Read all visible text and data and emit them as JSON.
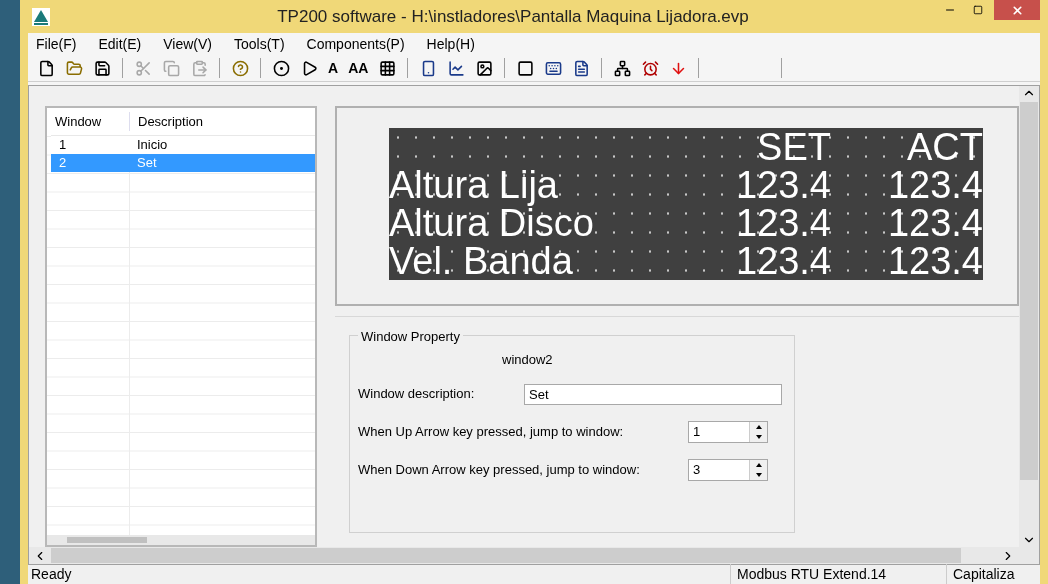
{
  "window": {
    "title": "TP200 software - H:\\instladores\\Pantalla Maquina Lijadora.evp"
  },
  "menu": [
    "File(F)",
    "Edit(E)",
    "View(V)",
    "Tools(T)",
    "Components(P)",
    "Help(H)"
  ],
  "toolbar": [
    {
      "kind": "icon",
      "disabled": false
    },
    {
      "kind": "icon",
      "disabled": false
    },
    {
      "kind": "icon",
      "disabled": false
    },
    {
      "kind": "separator"
    },
    {
      "kind": "icon",
      "disabled": true
    },
    {
      "kind": "icon",
      "disabled": true
    },
    {
      "kind": "icon",
      "disabled": true
    },
    {
      "kind": "separator"
    },
    {
      "kind": "icon",
      "disabled": false
    },
    {
      "kind": "separator"
    },
    {
      "kind": "icon",
      "disabled": false
    },
    {
      "kind": "icon",
      "disabled": false
    },
    {
      "kind": "text",
      "label": "A"
    },
    {
      "kind": "text",
      "label": "AA"
    },
    {
      "kind": "icon",
      "disabled": false
    },
    {
      "kind": "separator"
    },
    {
      "kind": "icon",
      "disabled": false
    },
    {
      "kind": "icon",
      "disabled": false
    },
    {
      "kind": "icon",
      "disabled": false
    },
    {
      "kind": "separator"
    },
    {
      "kind": "icon",
      "disabled": false
    },
    {
      "kind": "icon",
      "disabled": false
    },
    {
      "kind": "icon",
      "disabled": false
    },
    {
      "kind": "separator"
    },
    {
      "kind": "icon",
      "disabled": false
    },
    {
      "kind": "icon",
      "disabled": false
    },
    {
      "kind": "icon",
      "disabled": false
    },
    {
      "kind": "separator"
    }
  ],
  "window_list": {
    "columns": [
      "Window",
      "Description"
    ],
    "rows": [
      {
        "cells": [
          "1",
          "Inicio"
        ],
        "selected": false
      },
      {
        "cells": [
          "2",
          "Set"
        ],
        "selected": true
      }
    ]
  },
  "display": {
    "header": [
      "SET",
      "ACT"
    ],
    "rows": [
      {
        "label": "Altura Lija",
        "set": "123.4",
        "act": "123.4"
      },
      {
        "label": "Altura Disco",
        "set": "123.4",
        "act": "123.4"
      },
      {
        "label": "Vel. Banda",
        "set": "123.4",
        "act": "123.4"
      }
    ]
  },
  "property": {
    "title": "Window Property",
    "name": "window2",
    "description_label": "Window description:",
    "description_value": "Set",
    "spinners": [
      {
        "label": "When Up Arrow key pressed, jump to window:",
        "value": "1"
      },
      {
        "label": "When Down Arrow key pressed, jump to window:",
        "value": "3"
      }
    ]
  },
  "status_bar": [
    "Ready",
    "Modbus RTU Extend.14",
    "Capitaliza"
  ]
}
